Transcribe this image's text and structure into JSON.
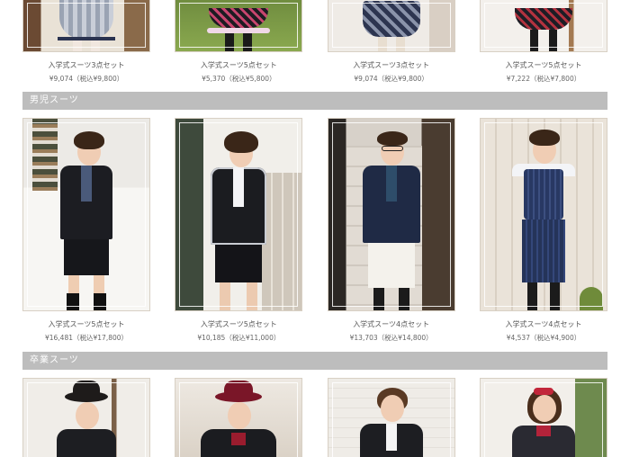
{
  "sections": [
    {
      "title": "",
      "products": [
        {
          "name": "入学式スーツ3点セット",
          "price": "¥9,074（税込¥9,800）"
        },
        {
          "name": "入学式スーツ5点セット",
          "price": "¥5,370（税込¥5,800）"
        },
        {
          "name": "入学式スーツ3点セット",
          "price": "¥9,074（税込¥9,800）"
        },
        {
          "name": "入学式スーツ5点セット",
          "price": "¥7,222（税込¥7,800）"
        }
      ]
    },
    {
      "title": "男児スーツ",
      "products": [
        {
          "name": "入学式スーツ5点セット",
          "price": "¥16,481（税込¥17,800）"
        },
        {
          "name": "入学式スーツ5点セット",
          "price": "¥10,185（税込¥11,000）"
        },
        {
          "name": "入学式スーツ4点セット",
          "price": "¥13,703（税込¥14,800）"
        },
        {
          "name": "入学式スーツ4点セット",
          "price": "¥4,537（税込¥4,900）"
        }
      ]
    },
    {
      "title": "卒業スーツ",
      "products": [
        {},
        {},
        {},
        {}
      ]
    }
  ],
  "colors": {
    "section_bar": "#bdbdbd",
    "border": "#d8d0c4"
  }
}
